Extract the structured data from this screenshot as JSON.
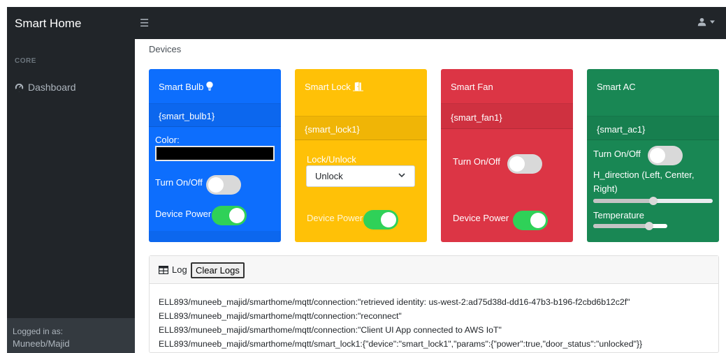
{
  "navbar": {
    "brand": "Smart Home"
  },
  "sidebar": {
    "heading": "CORE",
    "items": [
      {
        "label": "Dashboard"
      }
    ],
    "footer": {
      "caption": "Logged in as:",
      "user": "Muneeb/Majid"
    }
  },
  "breadcrumb": "Devices",
  "cards": {
    "bulb": {
      "title": "Smart Bulb",
      "id": "{smart_bulb1}",
      "color_label": "Color:",
      "color_value": "#000000",
      "toggle_label": "Turn On/Off",
      "toggle_on": false,
      "power_label": "Device Power",
      "power_on": true
    },
    "lock": {
      "title": "Smart Lock",
      "id": "{smart_lock1}",
      "select_label": "Lock/Unlock",
      "select_value": "Unlock",
      "power_label": "Device Power",
      "power_on": true
    },
    "fan": {
      "title": "Smart Fan",
      "id": "{smart_fan1}",
      "toggle_label": "Turn On/Off",
      "toggle_on": false,
      "power_label": "Device Power",
      "power_on": true
    },
    "ac": {
      "title": "Smart AC",
      "id": "{smart_ac1}",
      "toggle_label": "Turn On/Off",
      "toggle_on": false,
      "h_direction_label": "H_direction (Left, Center, Right)",
      "h_direction_value": 0.5,
      "temperature_label": "Temperature",
      "temperature_value": 0.75
    }
  },
  "colors": {
    "blue": "#0d6efd",
    "yellow": "#ffc107",
    "red": "#dc3545",
    "green": "#198754",
    "toggle_on": "#2fd158"
  },
  "log": {
    "title": "Log",
    "clear_label": "Clear Logs",
    "lines": [
      "ELL893/muneeb_majid/smarthome/mqtt/connection:\"retrieved identity: us-west-2:ad75d38d-dd16-47b3-b196-f2cbd6b12c2f\"",
      "ELL893/muneeb_majid/smarthome/mqtt/connection:\"reconnect\"",
      "ELL893/muneeb_majid/smarthome/mqtt/connection:\"Client UI App connected to AWS IoT\"",
      "ELL893/muneeb_majid/smarthome/mqtt/smart_lock1:{\"device\":\"smart_lock1\",\"params\":{\"power\":true,\"door_status\":\"unlocked\"}}"
    ]
  }
}
